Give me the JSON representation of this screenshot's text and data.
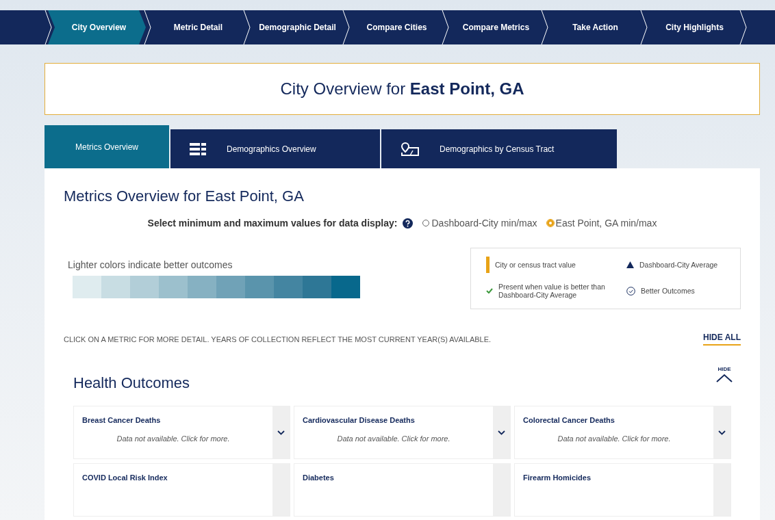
{
  "steps": [
    {
      "label": "City Overview",
      "selected": true
    },
    {
      "label": "Metric Detail",
      "selected": false
    },
    {
      "label": "Demographic Detail",
      "selected": false
    },
    {
      "label": "Compare Cities",
      "selected": false
    },
    {
      "label": "Compare Metrics",
      "selected": false
    },
    {
      "label": "Take Action",
      "selected": false
    },
    {
      "label": "City Highlights",
      "selected": false
    }
  ],
  "page_title": "City Overview for **East Point, GA**",
  "tabs": [
    {
      "label": "Metrics Overview",
      "kind": "plain",
      "selected": true
    },
    {
      "label": "Demographics Overview",
      "kind": "table",
      "selected": false
    },
    {
      "label": "Demographics by Census Tract",
      "kind": "map",
      "selected": false
    }
  ],
  "section_title": "Metrics Overview for East Point, GA",
  "range_selector": {
    "label": "Select minimum and maximum values for data display:",
    "options": [
      {
        "label": "Dashboard-City min/max",
        "selected": false
      },
      {
        "label": "East Point, GA min/max",
        "selected": true
      }
    ]
  },
  "scale": {
    "caption": "Lighter colors indicate better outcomes",
    "swatches": [
      {
        "color": "#dfecef"
      },
      {
        "color": "#c8dde3"
      },
      {
        "color": "#b2ced8"
      },
      {
        "color": "#9cc0cd"
      },
      {
        "color": "#86b1c2"
      },
      {
        "color": "#70a2b7"
      },
      {
        "color": "#5a94ac"
      },
      {
        "color": "#4485a1"
      },
      {
        "color": "#2e7796"
      },
      {
        "color": "#08688c"
      }
    ]
  },
  "legend": [
    {
      "kind": "bar",
      "label": "City or census tract value"
    },
    {
      "kind": "triangle",
      "label": "Dashboard-City Average"
    },
    {
      "kind": "check",
      "label": "Present when value is better than Dashboard-City Average"
    },
    {
      "kind": "circle-check",
      "label": "Better Outcomes"
    }
  ],
  "instructions": "CLICK ON A METRIC FOR MORE DETAIL. YEARS OF COLLECTION REFLECT THE MOST CURRENT YEAR(S) AVAILABLE.",
  "hide_all": "HIDE ALL",
  "group": {
    "title": "Health Outcomes",
    "toggle_label": "HIDE",
    "expanded": true,
    "metrics": [
      {
        "title": "Breast Cancer Deaths",
        "note": "Data not available. Click for more."
      },
      {
        "title": "Cardiovascular Disease Deaths",
        "note": "Data not available. Click for more."
      },
      {
        "title": "Colorectal Cancer Deaths",
        "note": "Data not available. Click for more."
      },
      {
        "title": "COVID Local Risk Index"
      },
      {
        "title": "Diabetes"
      },
      {
        "title": "Firearm Homicides"
      }
    ]
  }
}
